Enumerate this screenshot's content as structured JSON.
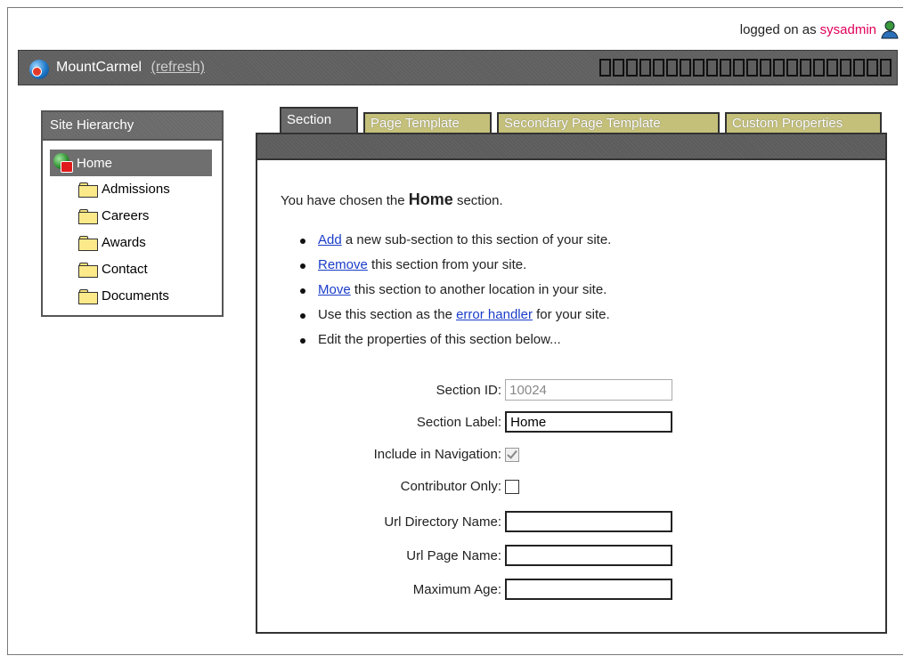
{
  "login": {
    "prefix": "logged on as",
    "user": "sysadmin"
  },
  "titlebar": {
    "app_name": "MountCarmel",
    "refresh": "(refresh)"
  },
  "sidebar": {
    "title": "Site Hierarchy",
    "root": "Home",
    "items": [
      {
        "label": "Admissions"
      },
      {
        "label": "Careers"
      },
      {
        "label": "Awards"
      },
      {
        "label": "Contact"
      },
      {
        "label": "Documents"
      }
    ]
  },
  "tabs": [
    {
      "label": "Section",
      "active": true
    },
    {
      "label": "Page Template",
      "active": false
    },
    {
      "label": "Secondary Page Template",
      "active": false
    },
    {
      "label": "Custom Properties",
      "active": false
    }
  ],
  "main": {
    "intro_before": "You have chosen the",
    "intro_section": "Home",
    "intro_after": "section.",
    "actions": [
      {
        "link": "Add",
        "text": " a new sub-section to this section of your site."
      },
      {
        "link": "Remove",
        "text": " this section from your site."
      },
      {
        "link": "Move",
        "text": " this section to another location in your site."
      },
      {
        "pre": "Use this section as the ",
        "link": "error handler",
        "text": " for your site."
      },
      {
        "text": "Edit the properties of this section below..."
      }
    ]
  },
  "form": {
    "section_id": {
      "label": "Section ID:",
      "value": "10024"
    },
    "section_label": {
      "label": "Section Label:",
      "value": "Home"
    },
    "include_nav": {
      "label": "Include in Navigation:",
      "checked": true
    },
    "contributor_only": {
      "label": "Contributor Only:",
      "checked": false
    },
    "url_dir": {
      "label": "Url Directory Name:",
      "value": ""
    },
    "url_page": {
      "label": "Url Page Name:",
      "value": ""
    },
    "max_age": {
      "label": "Maximum Age:",
      "value": ""
    }
  },
  "colors": {
    "titlebar": "#5f5f5f",
    "tab_active": "#6a6a6a",
    "tab_inactive": "#c4c07a",
    "link": "#1a3cc8",
    "user": "#e0005a"
  }
}
